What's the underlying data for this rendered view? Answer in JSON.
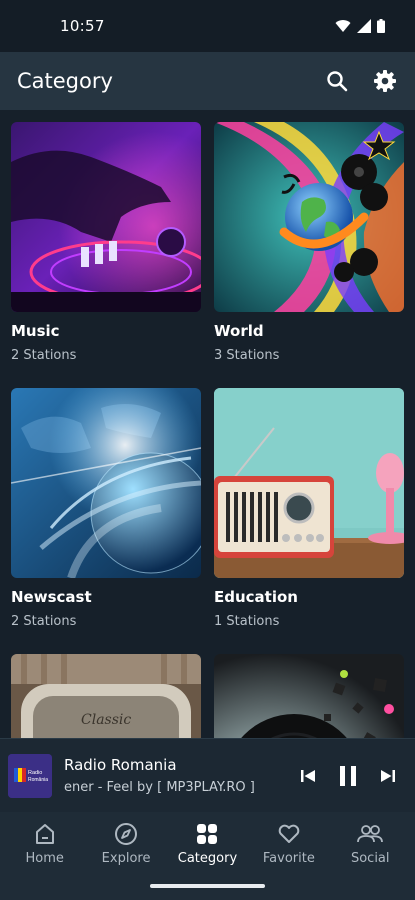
{
  "status": {
    "time": "10:57"
  },
  "app_bar": {
    "title": "Category"
  },
  "categories": [
    {
      "name": "Music",
      "count": "2 Stations"
    },
    {
      "name": "World",
      "count": "3 Stations"
    },
    {
      "name": "Newscast",
      "count": "2 Stations"
    },
    {
      "name": "Education",
      "count": "1 Stations"
    }
  ],
  "player": {
    "title": "Radio Romania",
    "subtitle": "ener - Feel by [ MP3PLAY.RO ]",
    "logo_text_1": "Radio",
    "logo_text_2": "România"
  },
  "nav": {
    "items": [
      {
        "label": "Home",
        "icon": "home-icon"
      },
      {
        "label": "Explore",
        "icon": "compass-icon"
      },
      {
        "label": "Category",
        "icon": "category-icon"
      },
      {
        "label": "Favorite",
        "icon": "heart-icon"
      },
      {
        "label": "Social",
        "icon": "people-icon"
      }
    ],
    "active": "Category"
  },
  "colors": {
    "background": "#16202a",
    "app_bar": "#263541",
    "player": "#1c2833",
    "nav": "#1f2c37"
  }
}
